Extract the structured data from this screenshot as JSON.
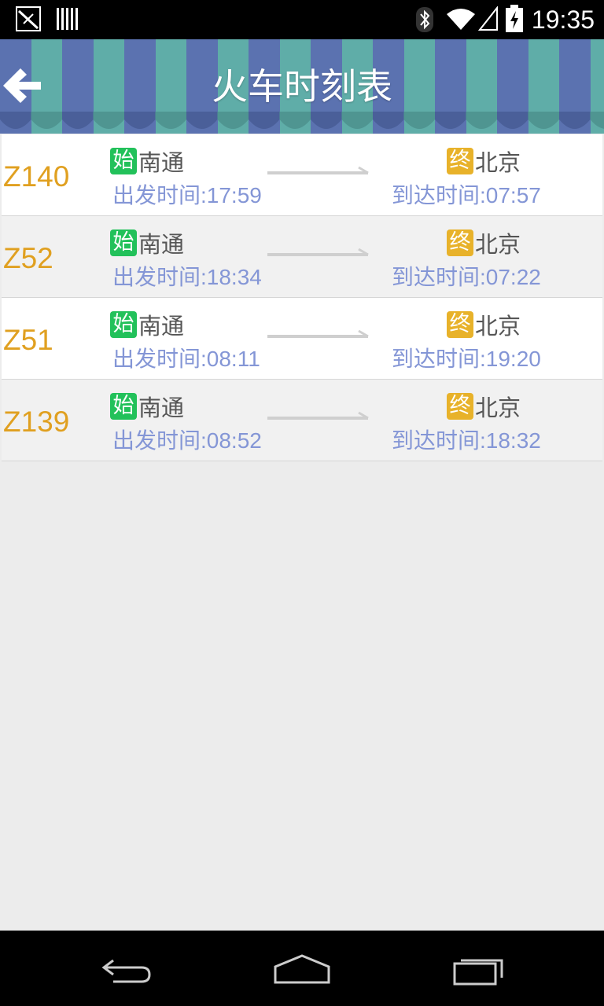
{
  "status_bar": {
    "time": "19:35",
    "icons": [
      "screenshot-icon",
      "barcode-icon",
      "bluetooth-icon",
      "wifi-icon",
      "signal-icon",
      "battery-icon"
    ]
  },
  "header": {
    "title": "火车时刻表",
    "back_icon": "back-arrow-icon"
  },
  "trains": [
    {
      "number": "Z140",
      "start_badge": "始",
      "from": "南通",
      "end_badge": "终",
      "to": "北京",
      "departure": "出发时间:17:59",
      "arrival": "到达时间:07:57"
    },
    {
      "number": "Z52",
      "start_badge": "始",
      "from": "南通",
      "end_badge": "终",
      "to": "北京",
      "departure": "出发时间:18:34",
      "arrival": "到达时间:07:22"
    },
    {
      "number": "Z51",
      "start_badge": "始",
      "from": "南通",
      "end_badge": "终",
      "to": "北京",
      "departure": "出发时间:08:11",
      "arrival": "到达时间:19:20"
    },
    {
      "number": "Z139",
      "start_badge": "始",
      "from": "南通",
      "end_badge": "终",
      "to": "北京",
      "departure": "出发时间:08:52",
      "arrival": "到达时间:18:32"
    }
  ],
  "colors": {
    "train_number": "#e0a020",
    "start_badge": "#22c15a",
    "end_badge": "#e8b22a",
    "time_text": "#8496d6",
    "stripe_blue": "#5b72b0",
    "stripe_teal": "#5fada8"
  },
  "nav_bar": {
    "icons": [
      "back-nav-icon",
      "home-nav-icon",
      "recents-nav-icon"
    ]
  }
}
